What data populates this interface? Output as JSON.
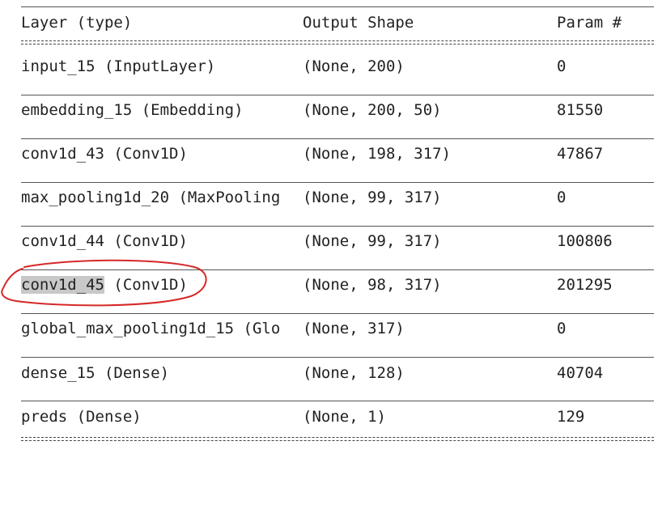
{
  "header": {
    "layer": "Layer (type)",
    "shape": "Output Shape",
    "param": "Param #"
  },
  "rows": [
    {
      "layer": "input_15 (InputLayer)",
      "shape": "(None, 200)",
      "param": "0"
    },
    {
      "layer": "embedding_15 (Embedding)",
      "shape": "(None, 200, 50)",
      "param": "81550"
    },
    {
      "layer": "conv1d_43 (Conv1D)",
      "shape": "(None, 198, 317)",
      "param": "47867"
    },
    {
      "layer": "max_pooling1d_20 (MaxPooling",
      "shape": "(None, 99, 317)",
      "param": "0"
    },
    {
      "layer": "conv1d_44 (Conv1D)",
      "shape": "(None, 99, 317)",
      "param": "100806"
    },
    {
      "layer_name": "conv1d_45",
      "layer_type": " (Conv1D)",
      "shape": "(None, 98, 317)",
      "param": "201295"
    },
    {
      "layer": "global_max_pooling1d_15 (Glo",
      "shape": "(None, 317)",
      "param": "0"
    },
    {
      "layer": "dense_15 (Dense)",
      "shape": "(None, 128)",
      "param": "40704"
    },
    {
      "layer": "preds (Dense)",
      "shape": "(None, 1)",
      "param": "129"
    }
  ],
  "colors": {
    "text": "#222222",
    "selection_highlight": "#c8c8c8",
    "annotation_circle": "#d62828"
  }
}
